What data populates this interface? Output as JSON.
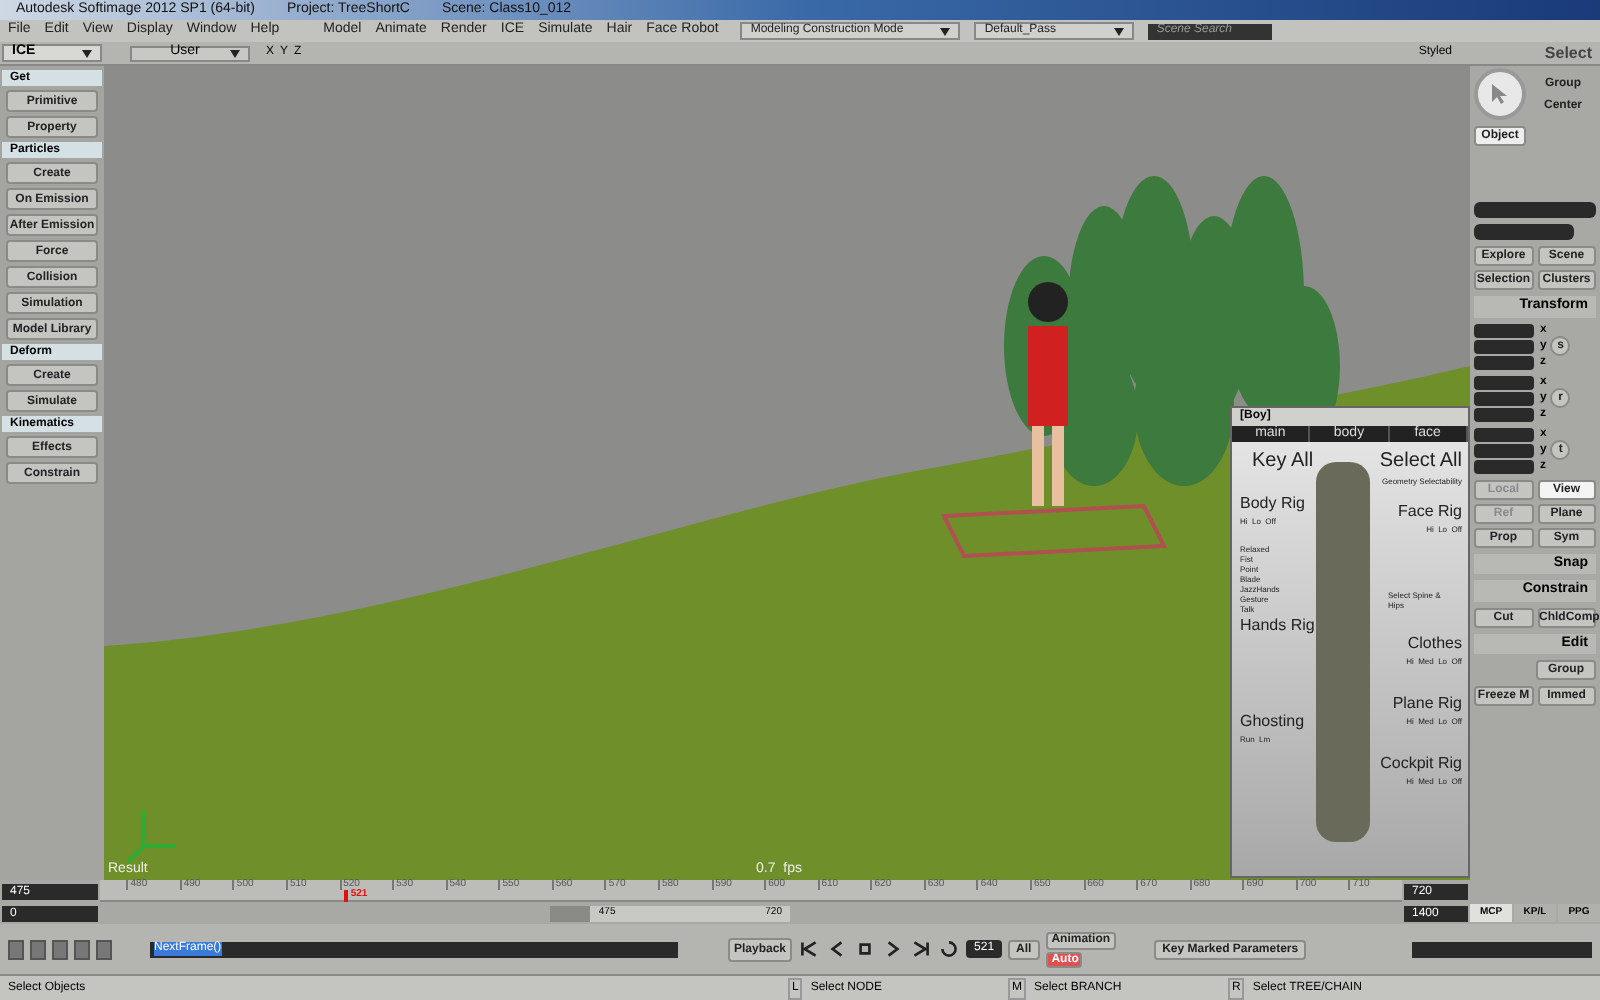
{
  "window": {
    "title": "Autodesk Softimage 2012 SP1 (64-bit)",
    "project": "Project: TreeShortC",
    "scene": "Scene: Class10_012"
  },
  "menu": {
    "left": [
      "File",
      "Edit",
      "View",
      "Display",
      "Window",
      "Help"
    ],
    "right": [
      "Model",
      "Animate",
      "Render",
      "ICE",
      "Simulate",
      "Hair",
      "Face Robot"
    ],
    "mode": "Modeling Construction Mode",
    "pass": "Default_Pass",
    "search_placeholder": "Scene Search"
  },
  "toolbar": {
    "panel": "ICE",
    "camera": "User",
    "axes": [
      "X",
      "Y",
      "Z"
    ],
    "display": "Styled"
  },
  "left_panel": [
    {
      "kind": "header",
      "label": "Get"
    },
    {
      "kind": "button",
      "label": "Primitive"
    },
    {
      "kind": "button",
      "label": "Property"
    },
    {
      "kind": "header",
      "label": "Particles"
    },
    {
      "kind": "button",
      "label": "Create"
    },
    {
      "kind": "button",
      "label": "On Emission"
    },
    {
      "kind": "button",
      "label": "After Emission"
    },
    {
      "kind": "button",
      "label": "Force"
    },
    {
      "kind": "button",
      "label": "Collision"
    },
    {
      "kind": "button",
      "label": "Simulation"
    },
    {
      "kind": "button",
      "label": "Model Library"
    },
    {
      "kind": "header",
      "label": "Deform"
    },
    {
      "kind": "button",
      "label": "Create"
    },
    {
      "kind": "button",
      "label": "Simulate"
    },
    {
      "kind": "header",
      "label": "Kinematics"
    },
    {
      "kind": "button",
      "label": "Effects"
    },
    {
      "kind": "button",
      "label": "Constrain"
    }
  ],
  "viewport": {
    "result": "Result",
    "fps": "0.7  fps"
  },
  "rig_panel": {
    "title": "[Boy]",
    "tabs": [
      {
        "label": "main",
        "selected": false
      },
      {
        "label": "body",
        "selected": false
      },
      {
        "label": "face",
        "selected": false
      }
    ],
    "key_all": "Key All",
    "select_all": "Select All",
    "geometry": "Geometry Selectability",
    "left": [
      {
        "title": "Body Rig",
        "options": "Hi  Lo  Off"
      },
      {
        "title": "Hands Rig",
        "poses": [
          "Relaxed",
          "Fist",
          "Point",
          "Blade",
          "JazzHands",
          "Gesture",
          "Talk"
        ]
      },
      {
        "title": "Ghosting",
        "options": "Run  Lm"
      }
    ],
    "right": [
      {
        "title": "Face Rig",
        "options": "Hi  Lo  Off"
      },
      {
        "title": "Clothes",
        "options": "Hi  Med  Lo  Off"
      },
      {
        "title": "Plane Rig",
        "options": "Hi  Med  Lo  Off"
      },
      {
        "title": "Cockpit Rig",
        "options": "Hi  Med  Lo  Off"
      }
    ],
    "spine": "Select Spine & Hips"
  },
  "right_panel": {
    "select": "Select",
    "group": "Group",
    "center": "Center",
    "object": "Object",
    "explore": "Explore",
    "scene": "Scene",
    "selection": "Selection",
    "clusters": "Clusters",
    "transform": "Transform",
    "groups": [
      {
        "key": "s",
        "axes": [
          "x",
          "y",
          "z"
        ]
      },
      {
        "key": "r",
        "axes": [
          "x",
          "y",
          "z"
        ]
      },
      {
        "key": "t",
        "axes": [
          "x",
          "y",
          "z"
        ]
      }
    ],
    "ref_buttons": [
      {
        "label": "Local",
        "disabled": true,
        "selected": false
      },
      {
        "label": "View",
        "disabled": false,
        "selected": true
      },
      {
        "label": "Ref",
        "disabled": true,
        "selected": false
      },
      {
        "label": "Plane",
        "disabled": false,
        "selected": false
      },
      {
        "label": "Prop",
        "disabled": false,
        "selected": false
      },
      {
        "label": "Sym",
        "disabled": false,
        "selected": false
      }
    ],
    "snap": "Snap",
    "constrain": "Constrain",
    "cut": "Cut",
    "chldcomp": "ChldComp",
    "edit": "Edit",
    "edit_group": "Group",
    "freeze": "Freeze M",
    "immed": "Immed"
  },
  "timeline": {
    "start": "475",
    "start2": "0",
    "end": "720",
    "end2": "1400",
    "range_start": "475",
    "range_end": "720",
    "ticks": [
      "480",
      "490",
      "500",
      "510",
      "520",
      "530",
      "540",
      "550",
      "560",
      "570",
      "580",
      "590",
      "600",
      "610",
      "620",
      "630",
      "640",
      "650",
      "660",
      "670",
      "680",
      "690",
      "700",
      "710"
    ],
    "current": "521",
    "level": 0.188,
    "range": {
      "level": 0.83
    }
  },
  "playback": {
    "command": "NextFrame()",
    "playback": "Playback",
    "frame": "521",
    "all": "All",
    "animation": "Animation",
    "auto": "Auto",
    "key_marked": "Key Marked Parameters",
    "tabs": [
      {
        "label": "MCP",
        "selected": true
      },
      {
        "label": "KP/L",
        "selected": false
      },
      {
        "label": "PPG",
        "selected": false
      }
    ]
  },
  "status_bar": {
    "message": "Select Objects",
    "items": [
      {
        "key": "L",
        "text": "Select NODE"
      },
      {
        "key": "M",
        "text": "Select BRANCH"
      },
      {
        "key": "R",
        "text": "Select TREE/CHAIN"
      }
    ]
  }
}
